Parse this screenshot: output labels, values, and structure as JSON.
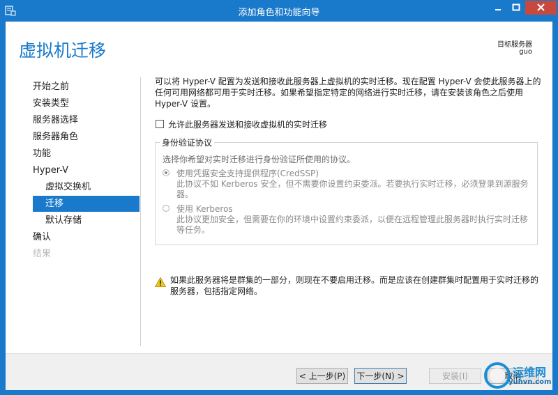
{
  "window": {
    "title": "添加角色和功能向导"
  },
  "header": {
    "page_title": "虚拟机迁移",
    "target_server_label": "目标服务器",
    "target_server_name": "guo"
  },
  "nav": {
    "items": [
      {
        "label": "开始之前",
        "state": "normal",
        "level": 0
      },
      {
        "label": "安装类型",
        "state": "normal",
        "level": 0
      },
      {
        "label": "服务器选择",
        "state": "normal",
        "level": 0
      },
      {
        "label": "服务器角色",
        "state": "normal",
        "level": 0
      },
      {
        "label": "功能",
        "state": "normal",
        "level": 0
      },
      {
        "label": "Hyper-V",
        "state": "normal",
        "level": 0
      },
      {
        "label": "虚拟交换机",
        "state": "normal",
        "level": 1
      },
      {
        "label": "迁移",
        "state": "active",
        "level": 1
      },
      {
        "label": "默认存储",
        "state": "normal",
        "level": 1
      },
      {
        "label": "确认",
        "state": "normal",
        "level": 0
      },
      {
        "label": "结果",
        "state": "disabled",
        "level": 0
      }
    ]
  },
  "content": {
    "intro": "可以将 Hyper-V 配置为发送和接收此服务器上虚拟机的实时迁移。现在配置 Hyper-V 会使此服务器上的任何可用网络都可用于实时迁移。如果希望指定特定的网络进行实时迁移，请在安装该角色之后使用 Hyper-V 设置。",
    "allow_checkbox_label": "允许此服务器发送和接收虚拟机的实时迁移",
    "allow_checked": false,
    "auth_group": {
      "legend": "身份验证协议",
      "description": "选择你希望对实时迁移进行身份验证所使用的协议。",
      "options": [
        {
          "label": "使用凭据安全支持提供程序(CredSSP)",
          "description": "此协议不如 Kerberos 安全，但不需要你设置约束委派。若要执行实时迁移，必须登录到源服务器。",
          "selected": true
        },
        {
          "label": "使用 Kerberos",
          "description": "此协议更加安全，但需要在你的环境中设置约束委派，以便在远程管理此服务器时执行实时迁移等任务。",
          "selected": false
        }
      ]
    },
    "warning": "如果此服务器将是群集的一部分，则现在不要启用迁移。而是应该在创建群集时配置用于实时迁移的服务器，包括指定网络。"
  },
  "footer": {
    "prev_label": "< 上一步(P)",
    "next_label": "下一步(N) >",
    "install_label": "安装(I)",
    "cancel_label": "取消"
  },
  "watermark": {
    "name": "运维网",
    "url": "yunvn.com"
  },
  "colors": {
    "accent": "#1979ca",
    "close": "#c7493e",
    "warning": "#f2c811"
  }
}
